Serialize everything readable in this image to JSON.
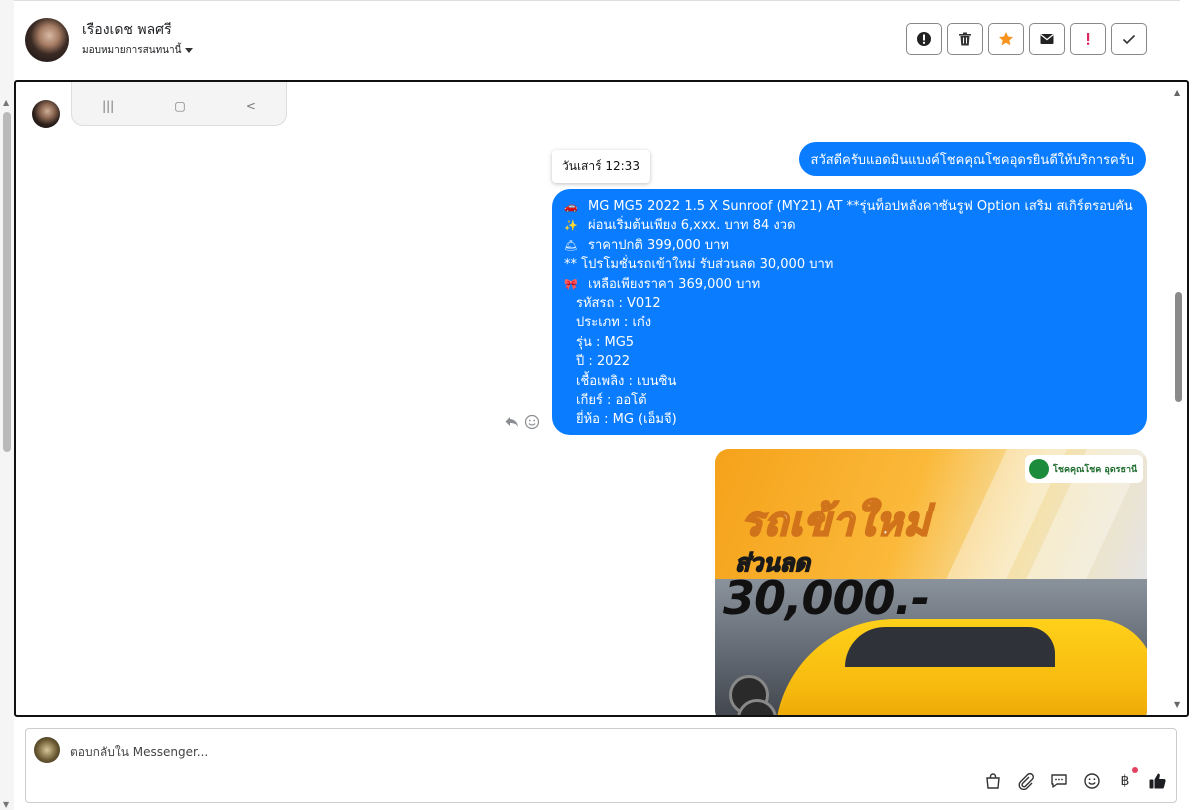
{
  "header": {
    "contact_name": "เรืองเดช พลศรี",
    "assign_label": "มอบหมายการสนทนานี้",
    "actions": [
      {
        "icon": "alert-circle-icon"
      },
      {
        "icon": "trash-icon"
      },
      {
        "icon": "star-icon",
        "color": "#f7931e"
      },
      {
        "icon": "envelope-icon"
      },
      {
        "icon": "exclamation-icon",
        "color": "#e0245e"
      },
      {
        "icon": "check-icon"
      }
    ]
  },
  "conversation": {
    "phone_nav": [
      "|||",
      "▢",
      "<"
    ],
    "timestamp_tooltip": "วันเสาร์ 12:33",
    "messages": [
      {
        "from": "page",
        "text": "สวัสดีครับแอดมินแบงค์โชคคุณโชคอุดรยินดีให้บริการครับ"
      },
      {
        "from": "page",
        "lines": [
          {
            "emoji": "🚗",
            "text": "MG MG5 2022 1.5 X Sunroof (MY21) AT **รุ่นท็อปหลังคาซันรูฟ Option เสริม สเกิร์ตรอบคัน"
          },
          {
            "emoji": "✨",
            "text": "ผ่อนเริ่มต้นเพียง 6,xxx. บาท 84 งวด"
          },
          {
            "emoji": "🛎",
            "text": "ราคาปกติ 399,000 บาท"
          },
          {
            "emoji": "",
            "text": "** โปรโมชั่นรถเข้าใหม่ รับส่วนลด 30,000 บาท"
          },
          {
            "emoji": "🎀",
            "text": "เหลือเพียงราคา 369,000 บาท"
          },
          {
            "emoji": "",
            "indent": true,
            "text": "รหัสรถ : V012"
          },
          {
            "emoji": "",
            "indent": true,
            "text": "ประเภท : เก๋ง"
          },
          {
            "emoji": "",
            "indent": true,
            "text": "รุ่น : MG5"
          },
          {
            "emoji": "",
            "indent": true,
            "text": "ปี : 2022"
          },
          {
            "emoji": "",
            "indent": true,
            "text": "เชื้อเพลิง : เบนซิน"
          },
          {
            "emoji": "",
            "indent": true,
            "text": "เกียร์ : ออโต้"
          },
          {
            "emoji": "",
            "indent": true,
            "text": "ยี่ห้อ : MG (เอ็มจี)"
          }
        ]
      },
      {
        "from": "page",
        "type": "image",
        "headline": "รถเข้าใหม่",
        "subheadline": "ส่วนลด",
        "amount": "30,000.-",
        "logo_text": "โชคคุณโชค อุดรธานี"
      }
    ]
  },
  "composer": {
    "placeholder": "ตอบกลับใน Messenger...",
    "tools": [
      "shopping-bag-icon",
      "paperclip-icon",
      "chat-bubble-icon",
      "smiley-icon",
      "baht-icon",
      "thumbs-up-icon"
    ],
    "baht_symbol": "฿"
  },
  "colors": {
    "bubble": "#0a7cff",
    "like": "#1c1e21"
  }
}
